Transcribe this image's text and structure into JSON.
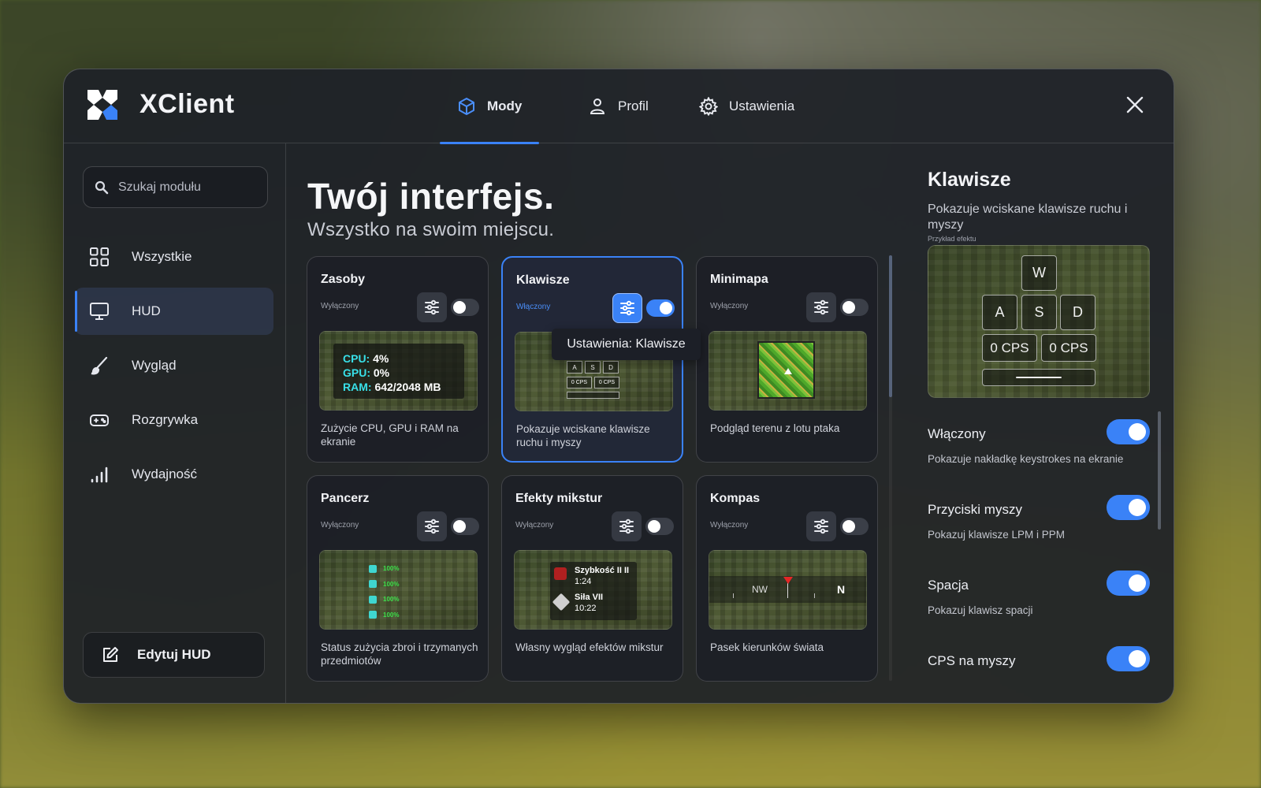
{
  "app": {
    "name": "XClient"
  },
  "nav": {
    "tabs": [
      {
        "label": "Mody",
        "icon": "cube-icon",
        "active": true
      },
      {
        "label": "Profil",
        "icon": "user-icon",
        "active": false
      },
      {
        "label": "Ustawienia",
        "icon": "gear-icon",
        "active": false
      }
    ]
  },
  "sidebar": {
    "search_placeholder": "Szukaj modułu",
    "items": [
      {
        "label": "Wszystkie",
        "icon": "grid-icon",
        "active": false
      },
      {
        "label": "HUD",
        "icon": "monitor-icon",
        "active": true
      },
      {
        "label": "Wygląd",
        "icon": "brush-icon",
        "active": false
      },
      {
        "label": "Rozgrywka",
        "icon": "gamepad-icon",
        "active": false
      },
      {
        "label": "Wydajność",
        "icon": "bars-icon",
        "active": false
      }
    ],
    "edit_button": "Edytuj HUD"
  },
  "main": {
    "title": "Twój interfejs.",
    "subtitle": "Wszystko na swoim miejscu.",
    "tooltip": "Ustawienia: Klawisze",
    "cards": [
      {
        "title": "Zasoby",
        "status": "Wyłączony",
        "enabled": false,
        "description": "Zużycie CPU, GPU i RAM na ekranie",
        "preview": {
          "cpu_label": "CPU:",
          "cpu": "4%",
          "gpu_label": "GPU:",
          "gpu": "0%",
          "ram_label": "RAM:",
          "ram": "642/2048 MB"
        }
      },
      {
        "title": "Klawisze",
        "status": "Włączony",
        "enabled": true,
        "description": "Pokazuje wciskane klawisze ruchu i myszy",
        "preview": {
          "keys": [
            "A",
            "S",
            "D"
          ],
          "cps": [
            "0 CPS",
            "0 CPS"
          ]
        }
      },
      {
        "title": "Minimapa",
        "status": "Wyłączony",
        "enabled": false,
        "description": "Podgląd terenu z lotu ptaka"
      },
      {
        "title": "Pancerz",
        "status": "Wyłączony",
        "enabled": false,
        "description": "Status zużycia zbroi i trzymanych przedmiotów",
        "preview": {
          "values": [
            "100%",
            "100%",
            "100%",
            "100%"
          ]
        }
      },
      {
        "title": "Efekty mikstur",
        "status": "Wyłączony",
        "enabled": false,
        "description": "Własny wygląd efektów mikstur",
        "preview": {
          "effects": [
            {
              "name": "Szybkość II II",
              "time": "1:24"
            },
            {
              "name": "Siła VII",
              "time": "10:22"
            }
          ]
        }
      },
      {
        "title": "Kompas",
        "status": "Wyłączony",
        "enabled": false,
        "description": "Pasek kierunków świata",
        "preview": {
          "left": "NW",
          "right": "N"
        }
      }
    ]
  },
  "panel": {
    "title": "Klawisze",
    "description": "Pokazuje wciskane klawisze ruchu i myszy",
    "example_label": "Przykład efektu",
    "preview": {
      "w": "W",
      "a": "A",
      "s": "S",
      "d": "D",
      "cps_left": "0 CPS",
      "cps_right": "0 CPS"
    },
    "options": [
      {
        "label": "Włączony",
        "description": "Pokazuje nakładkę keystrokes na ekranie",
        "enabled": true
      },
      {
        "label": "Przyciski myszy",
        "description": "Pokazuj klawisze LPM i PPM",
        "enabled": true
      },
      {
        "label": "Spacja",
        "description": "Pokazuj klawisz spacji",
        "enabled": true
      },
      {
        "label": "CPS na myszy",
        "description": "",
        "enabled": true
      }
    ]
  },
  "colors": {
    "accent": "#3a82f7",
    "cyan": "#38e0e8",
    "green": "#3be04a"
  }
}
